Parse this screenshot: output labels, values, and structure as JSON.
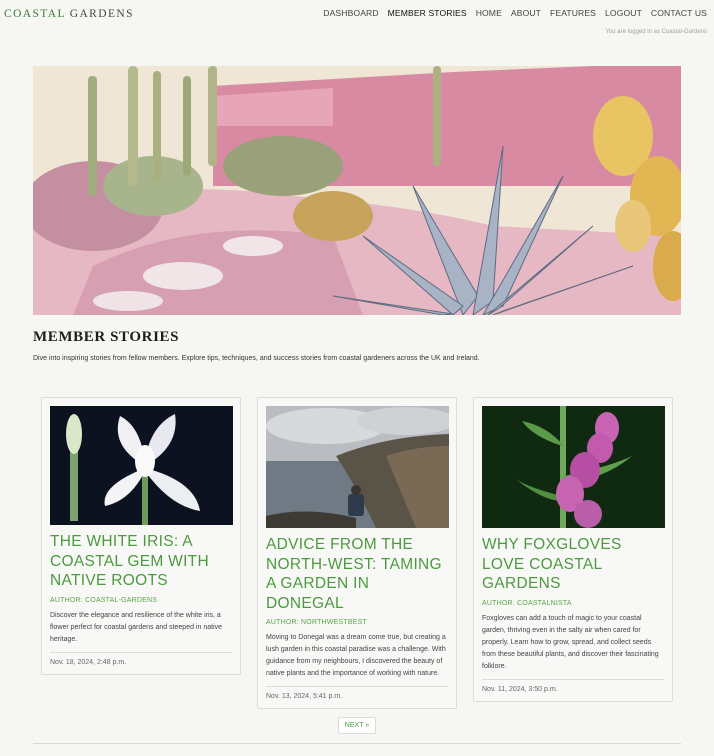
{
  "site": {
    "brand_part1": "COASTAL",
    "brand_part2": "GARDENS"
  },
  "nav": {
    "items": [
      {
        "label": "DASHBOARD"
      },
      {
        "label": "MEMBER STORIES"
      },
      {
        "label": "HOME"
      },
      {
        "label": "ABOUT"
      },
      {
        "label": "FEATURES"
      },
      {
        "label": "LOGOUT"
      },
      {
        "label": "CONTACT US"
      }
    ],
    "active": "MEMBER STORIES"
  },
  "session": {
    "logged_in_text": "You are logged in as Coastal-Gardens"
  },
  "page": {
    "title": "MEMBER STORIES",
    "intro": "Dive into inspiring stories from fellow members. Explore tips, techniques, and success stories from coastal gardeners across the UK and Ireland."
  },
  "stories": [
    {
      "title": "THE WHITE IRIS: A COASTAL GEM WITH NATIVE ROOTS",
      "author": "AUTHOR: COASTAL-GARDENS",
      "excerpt": "Discover the elegance and resilience of the white iris, a flower perfect for coastal gardens and steeped in native heritage.",
      "date": "Nov. 18, 2024, 2:48 p.m.",
      "image_icon": "white-iris-image"
    },
    {
      "title": "ADVICE FROM THE NORTH-WEST: TAMING A GARDEN IN DONEGAL",
      "author": "AUTHOR: NORTHWESTBEST",
      "excerpt": "Moving to Donegal was a dream come true, but creating a lush garden in this coastal paradise was a challenge. With guidance from my neighbours, I discovered the beauty of native plants and the importance of working with nature.",
      "date": "Nov. 13, 2024, 5:41 p.m.",
      "image_icon": "donegal-coast-image"
    },
    {
      "title": "WHY FOXGLOVES LOVE COASTAL GARDENS",
      "author": "AUTHOR: COASTALNISTA",
      "excerpt": "Foxgloves can add a touch of magic to your coastal garden, thriving even in the salty air when cared for properly. Learn how to grow, spread, and collect seeds from these beautiful plants, and discover their fascinating folklore.",
      "date": "Nov. 11, 2024, 3:50 p.m.",
      "image_icon": "foxglove-image"
    }
  ],
  "pagination": {
    "next_label": "NEXT »"
  },
  "colors": {
    "accent": "#4c9a3f",
    "background": "#f6f6f3"
  }
}
